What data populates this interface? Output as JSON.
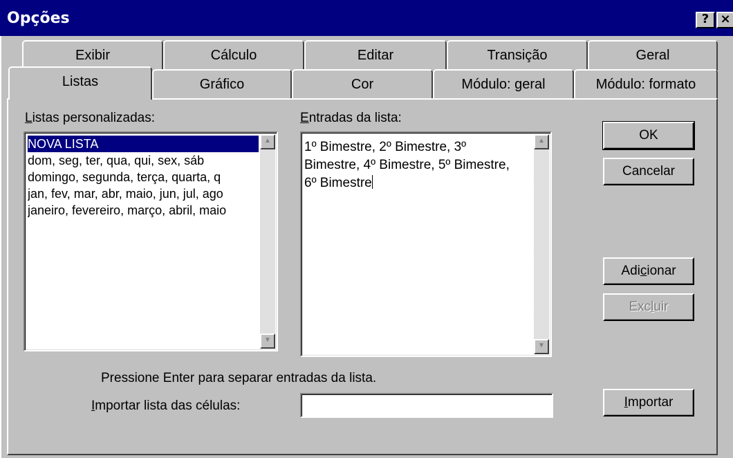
{
  "window": {
    "title": "Opções",
    "help_glyph": "?",
    "close_glyph": "×"
  },
  "tabs": {
    "row1": [
      "Exibir",
      "Cálculo",
      "Editar",
      "Transição",
      "Geral"
    ],
    "row2": [
      "Listas",
      "Gráfico",
      "Cor",
      "Módulo: geral",
      "Módulo: formato"
    ],
    "active": "Listas"
  },
  "lists": {
    "custom_label_accel": "L",
    "custom_label_rest": "istas personalizadas:",
    "items": [
      "NOVA LISTA",
      "dom, seg, ter, qua, qui, sex, sáb",
      "domingo, segunda, terça, quarta, q",
      "jan, fev, mar, abr, maio, jun, jul, ago",
      "janeiro, fevereiro, março, abril, maio"
    ],
    "selected_index": 0,
    "entries_label_accel": "E",
    "entries_label_rest": "ntradas da lista:",
    "entries_text": "1º Bimestre, 2º Bimestre, 3º\nBimestre, 4º Bimestre, 5º Bimestre,\n6º Bimestre"
  },
  "buttons": {
    "ok": "OK",
    "cancel": "Cancelar",
    "add_pre": "Adi",
    "add_accel": "c",
    "add_post": "ionar",
    "delete_pre": "Exc",
    "delete_accel": "l",
    "delete_post": "uir",
    "import_accel": "I",
    "import_rest": "mportar"
  },
  "hint": "Pressione Enter para separar entradas da lista.",
  "import_field": {
    "label_accel": "I",
    "label_rest": "mportar lista das células:",
    "value": ""
  },
  "colors": {
    "titlebar": "#000080",
    "face": "#c0c0c0",
    "selection": "#000080"
  }
}
